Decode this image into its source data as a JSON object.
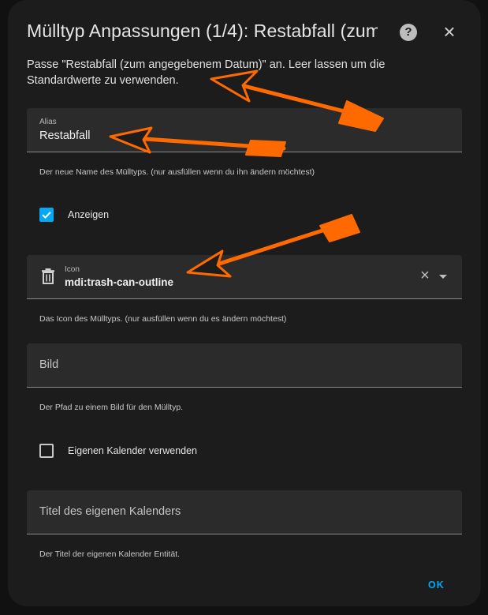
{
  "dialog": {
    "title": "Mülltyp Anpassungen (1/4): Restabfall (zum ...",
    "description": "Passe \"Restabfall (zum angegebenem Datum)\" an. Leer lassen um die Standardwerte zu verwenden.",
    "help_icon": "help-circle-icon",
    "close_icon": "close-icon"
  },
  "alias_field": {
    "label": "Alias",
    "value": "Restabfall",
    "helper": "Der neue Name des Mülltyps. (nur ausfüllen wenn du ihn ändern möchtest)"
  },
  "show_checkbox": {
    "label": "Anzeigen",
    "checked": true
  },
  "icon_field": {
    "label": "Icon",
    "value": "mdi:trash-can-outline",
    "helper": "Das Icon des Mülltyps. (nur ausfüllen wenn du es ändern möchtest)",
    "icon": "trash-can-outline-icon"
  },
  "image_field": {
    "placeholder": "Bild",
    "helper": "Der Pfad zu einem Bild für den Mülltyp."
  },
  "calendar_checkbox": {
    "label": "Eigenen Kalender verwenden",
    "checked": false
  },
  "calendar_title_field": {
    "placeholder": "Titel des eigenen Kalenders",
    "helper": "Der Titel der eigenen Kalender Entität."
  },
  "actions": {
    "ok_label": "OK"
  },
  "colors": {
    "accent": "#03a9f4",
    "annotation_arrow": "#ff6a00"
  }
}
